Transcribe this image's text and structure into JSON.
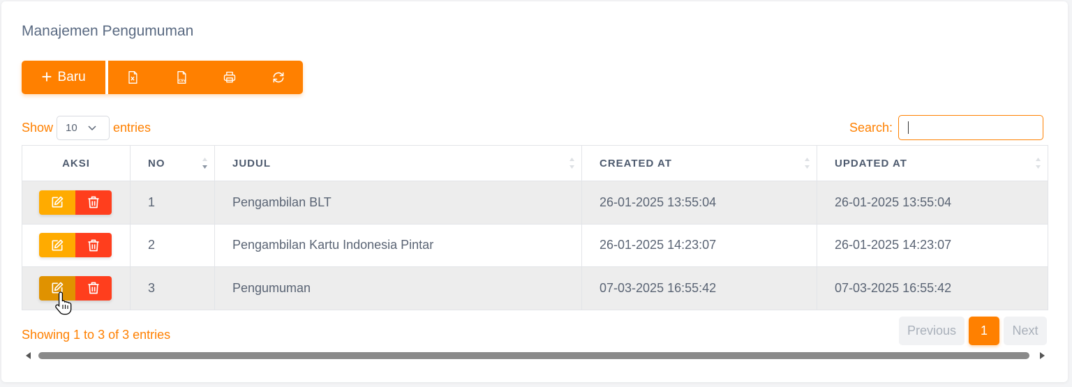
{
  "page": {
    "title": "Manajemen Pengumuman"
  },
  "toolbar": {
    "new_label": "Baru",
    "new_icon": "plus-icon",
    "tools": [
      "excel-file-icon",
      "csv-file-icon",
      "printer-icon",
      "refresh-icon"
    ]
  },
  "length": {
    "show_label": "Show",
    "value": "10",
    "entries_label": "entries"
  },
  "search": {
    "label": "Search:",
    "value": ""
  },
  "table": {
    "columns": [
      "AKSI",
      "NO",
      "JUDUL",
      "CREATED AT",
      "UPDATED AT"
    ],
    "rows": [
      {
        "no": "1",
        "judul": "Pengambilan BLT",
        "created": "26-01-2025 13:55:04",
        "updated": "26-01-2025 13:55:04"
      },
      {
        "no": "2",
        "judul": "Pengambilan Kartu Indonesia Pintar",
        "created": "26-01-2025 14:23:07",
        "updated": "26-01-2025 14:23:07"
      },
      {
        "no": "3",
        "judul": "Pengumuman",
        "created": "07-03-2025 16:55:42",
        "updated": "07-03-2025 16:55:42"
      }
    ]
  },
  "info": "Showing 1 to 3 of 3 entries",
  "pagination": {
    "previous": "Previous",
    "current": "1",
    "next": "Next"
  },
  "colors": {
    "accent": "#ff8000",
    "edit": "#ffab00",
    "delete": "#ff3e1d"
  }
}
